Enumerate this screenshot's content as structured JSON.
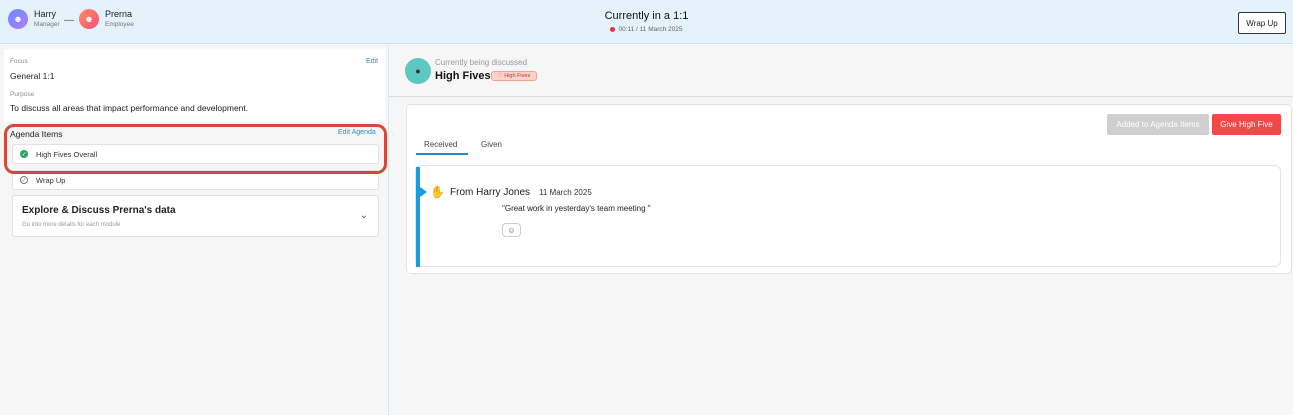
{
  "header": {
    "manager": {
      "name": "Harry",
      "role": "Manager"
    },
    "employee": {
      "name": "Prerna",
      "role": "Employee"
    },
    "title": "Currently in a 1:1",
    "timer": "00:11 / 11 March 2025",
    "wrap_up_label": "Wrap Up"
  },
  "left": {
    "focus_label": "Focus",
    "focus_value": "General 1:1",
    "edit_label": "Edit",
    "purpose_label": "Purpose",
    "purpose_value": "To discuss all areas that impact performance and development.",
    "agenda_label": "Agenda Items",
    "edit_agenda_label": "Edit Agenda",
    "agenda_items": [
      {
        "label": "High Fives Overall",
        "done": true
      },
      {
        "label": "Wrap Up",
        "done": false
      }
    ],
    "explore_title": "Explore & Discuss Prerna's data",
    "explore_sub": "Go into more details for each module"
  },
  "main": {
    "discussing_label": "Currently being discussed",
    "discussing_title": "High Fives",
    "tag_label": "High Fives",
    "added_button": "Added to Agenda Items",
    "give_button": "Give High Five",
    "tabs": [
      "Received",
      "Given"
    ],
    "active_tab": "Received",
    "feed": {
      "from": "From Harry Jones",
      "date": "11 March 2025",
      "message": "\"Great work in yesterday's team meeting \""
    }
  },
  "colors": {
    "accent": "#1a8bd1",
    "danger": "#ef4a4a",
    "highlight": "#d6483a",
    "success": "#25a566"
  }
}
